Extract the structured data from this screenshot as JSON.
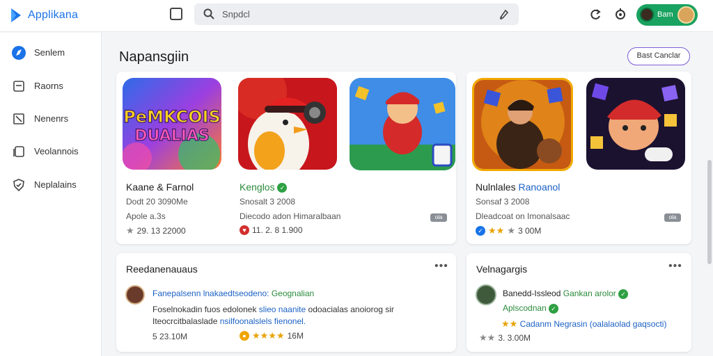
{
  "app": {
    "name": "Applikana"
  },
  "search": {
    "placeholder": "Snpdcl"
  },
  "user": {
    "name": "Bam"
  },
  "sidebar": {
    "items": [
      {
        "label": "Senlem",
        "icon": "compass-icon"
      },
      {
        "label": "Raorns",
        "icon": "screen-icon"
      },
      {
        "label": "Nenenrs",
        "icon": "tag-icon"
      },
      {
        "label": "Veolannois",
        "icon": "copy-icon"
      },
      {
        "label": "Neplalains",
        "icon": "shield-icon"
      }
    ]
  },
  "main": {
    "title": "Napansgiin",
    "action_label": "Bast Canclar"
  },
  "apps": [
    {
      "title": "Kaane & Farnol",
      "title_tail": "",
      "line1": "Dodt 20 3090Me",
      "line2": "Apole a.3s",
      "rating": "29. 13 22000",
      "logo_text_1": "PeMKCOIS",
      "logo_text_2": "DUALIAS"
    },
    {
      "title": "Kenglos",
      "title_tail": "",
      "line1": "Snosalt 3 2008",
      "line2": "Diecodo adon Himaralbaan",
      "rating": "11. 2. 8 1.900"
    },
    {
      "title": "Nulnlales",
      "title_tail": "Ranoanol",
      "line1": "Sonsaf 3 2008",
      "line2": "Dleadcoat on Imonalsaac",
      "rating": "3 00M"
    }
  ],
  "reviews": [
    {
      "heading": "Reedanenauaus",
      "name": "Fanepalsenn lnakaedtseodeno:",
      "name_tail": "Geognalian",
      "text_1": "Foselnokadin fuos edolonek",
      "text_1_blue": "slieo naanite",
      "text_1_end": "odoacialas anoiorog sir",
      "text_2": "Iteocrcitbalaslade",
      "text_2_blue": "nsilfoonalslels fienonel.",
      "rating": "5 23.10M",
      "rating_2": "16M"
    },
    {
      "heading": "Velnagargis",
      "name": "Banedd-Issleod",
      "name_tail": "Gankan arolor",
      "line_2": "Aplscodnan",
      "line_3": "Cadanm Negrasin",
      "line_3_tail": "(oalalaolad gaqsocti)",
      "rating": "3. 3.00M"
    }
  ],
  "badges": {
    "mini": "ola"
  }
}
